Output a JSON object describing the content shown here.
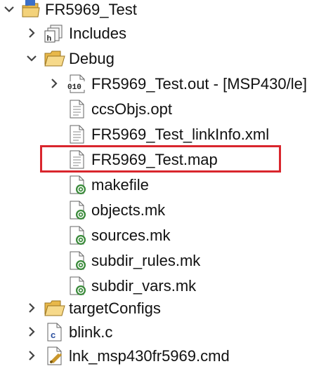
{
  "tree": {
    "root": {
      "label": "FR5969_Test",
      "icon": "project-folder-icon",
      "expanded": true
    },
    "includes": {
      "label": "Includes",
      "icon": "includes-icon",
      "expanded": false
    },
    "debug": {
      "label": "Debug",
      "icon": "folder-open-icon",
      "expanded": true
    },
    "out_file": {
      "label": "FR5969_Test.out - [MSP430/le]",
      "icon": "binary-file-icon",
      "expanded": false
    },
    "ccsobjs": {
      "label": "ccsObjs.opt",
      "icon": "text-file-icon"
    },
    "linkinfo": {
      "label": "FR5969_Test_linkInfo.xml",
      "icon": "text-file-icon"
    },
    "map_file": {
      "label": "FR5969_Test.map",
      "icon": "text-file-icon",
      "highlighted": true
    },
    "makefile": {
      "label": "makefile",
      "icon": "makefile-icon"
    },
    "objects_mk": {
      "label": "objects.mk",
      "icon": "makefile-icon"
    },
    "sources_mk": {
      "label": "sources.mk",
      "icon": "makefile-icon"
    },
    "subdir_rules": {
      "label": "subdir_rules.mk",
      "icon": "makefile-icon"
    },
    "subdir_vars": {
      "label": "subdir_vars.mk",
      "icon": "makefile-icon"
    },
    "target_configs": {
      "label": "targetConfigs",
      "icon": "folder-icon",
      "expanded": false
    },
    "blink_c": {
      "label": "blink.c",
      "icon": "c-source-file-icon",
      "expanded": false
    },
    "lnk_cmd": {
      "label": "lnk_msp430fr5969.cmd",
      "icon": "linker-cmd-file-icon",
      "expanded": false
    }
  },
  "colors": {
    "highlight": "#d9262d",
    "folder": "#e8b84a",
    "makefile_badge": "#3a8a3a"
  }
}
